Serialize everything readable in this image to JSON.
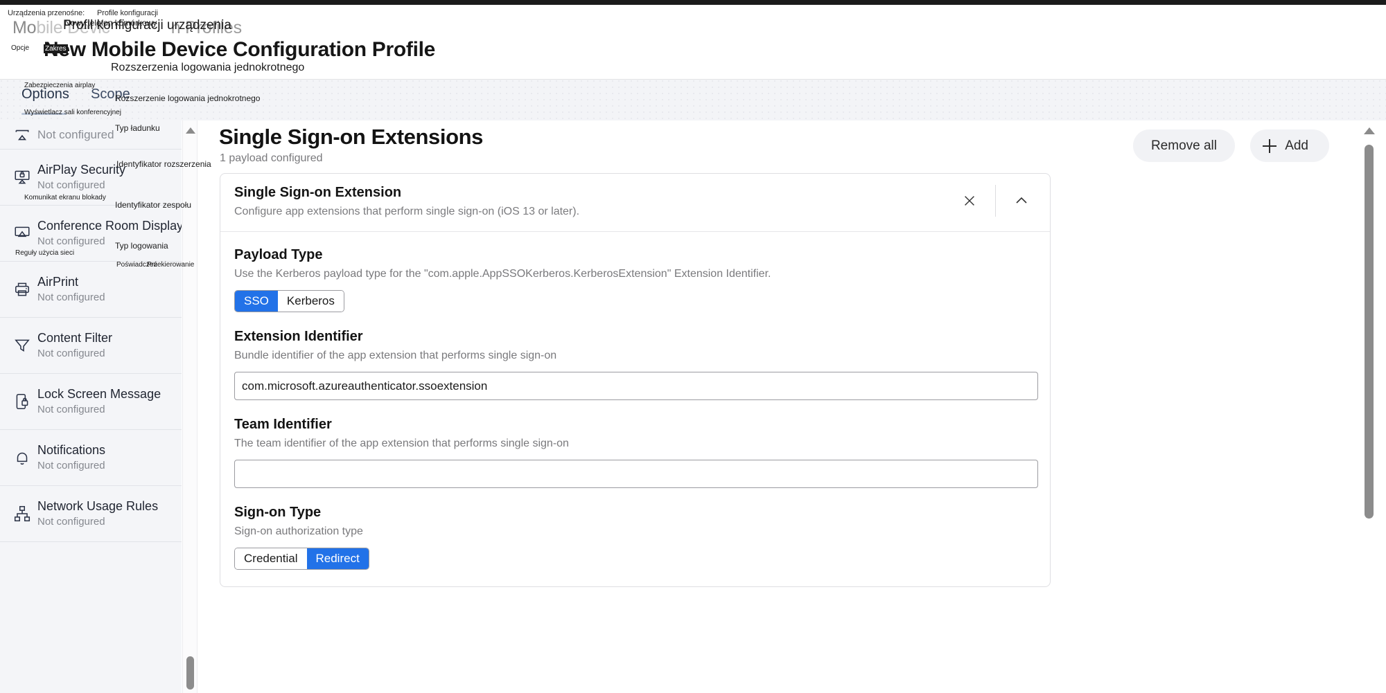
{
  "breadcrumb": {
    "items": [
      "Urządzenia przenośne:",
      "Profile konfiguracji"
    ]
  },
  "header": {
    "app_name_lead": "Mo",
    "app_name_faded": "bile Devic",
    "app_name_tail": "n Profiles",
    "page_title": "New Mobile Device Configuration Profile"
  },
  "tabs": [
    {
      "label": "Options",
      "selected": true
    },
    {
      "label": "Scope",
      "selected": false
    }
  ],
  "sidebar": {
    "items": [
      {
        "icon": "airplay-icon",
        "title": "",
        "subtitle": "Not configured"
      },
      {
        "icon": "airplay-security-icon",
        "title": "AirPlay Security",
        "subtitle": "Not configured"
      },
      {
        "icon": "conference-room-display-icon",
        "title": "Conference Room Display",
        "subtitle": "Not configured"
      },
      {
        "icon": "airprint-icon",
        "title": "AirPrint",
        "subtitle": "Not configured"
      },
      {
        "icon": "content-filter-icon",
        "title": "Content Filter",
        "subtitle": "Not configured"
      },
      {
        "icon": "lock-screen-message-icon",
        "title": "Lock Screen Message",
        "subtitle": "Not configured"
      },
      {
        "icon": "notifications-icon",
        "title": "Notifications",
        "subtitle": "Not configured"
      },
      {
        "icon": "network-usage-rules-icon",
        "title": "Network Usage Rules",
        "subtitle": "Not configured"
      }
    ]
  },
  "main": {
    "title": "Single Sign-on Extensions",
    "subtitle": "1 payload configured",
    "remove_all_label": "Remove all",
    "add_label": "Add",
    "card": {
      "title": "Single Sign-on Extension",
      "subtitle": "Configure app extensions that perform single sign-on (iOS 13 or later).",
      "fields": {
        "payload_type": {
          "label": "Payload Type",
          "desc": "Use the Kerberos payload type for the \"com.apple.AppSSOKerberos.KerberosExtension\" Extension Identifier.",
          "options": [
            "SSO",
            "Kerberos"
          ],
          "selected": "SSO"
        },
        "extension_identifier": {
          "label": "Extension Identifier",
          "desc": "Bundle identifier of the app extension that performs single sign-on",
          "value": "com.microsoft.azureauthenticator.ssoextension",
          "placeholder": ""
        },
        "team_identifier": {
          "label": "Team Identifier",
          "desc": "The team identifier of the app extension that performs single sign-on",
          "value": "",
          "placeholder": ""
        },
        "sign_on_type": {
          "label": "Sign-on Type",
          "desc": "Sign-on authorization type",
          "options": [
            "Credential",
            "Redirect"
          ],
          "selected": "Redirect"
        }
      }
    }
  },
  "translation_overlay": {
    "new_mobile_phone": "Nowy telefon komórkowy",
    "device_configuration_profile": "Profil konfiguracji urządzenia",
    "options": "Opcje",
    "scope": "Zakres",
    "sso_extensions": "Rozszerzenia logowania jednokrotnego",
    "airplay_security": "Zabezpieczenia airplay",
    "sso_extension": "Rozszerzenie logowania jednokrotnego",
    "conference_room_display": "Wyświetlacz sali konferencyjnej",
    "payload_type": "Typ ładunku",
    "extension_identifier": "Identyfikator rozszerzenia",
    "lock_screen_message": "Komunikat ekranu blokady",
    "team_identifier": "Identyfikator zespołu",
    "network_usage_rules": "Reguły użycia sieci",
    "sign_on_type": "Typ logowania",
    "credential": "Poświadczeń",
    "redirect": "Przekierowanie"
  },
  "colors": {
    "accent_blue": "#2272e8",
    "sidebar_bg": "#f4f5f8",
    "tabstrip_bg": "#f3f4f7"
  }
}
